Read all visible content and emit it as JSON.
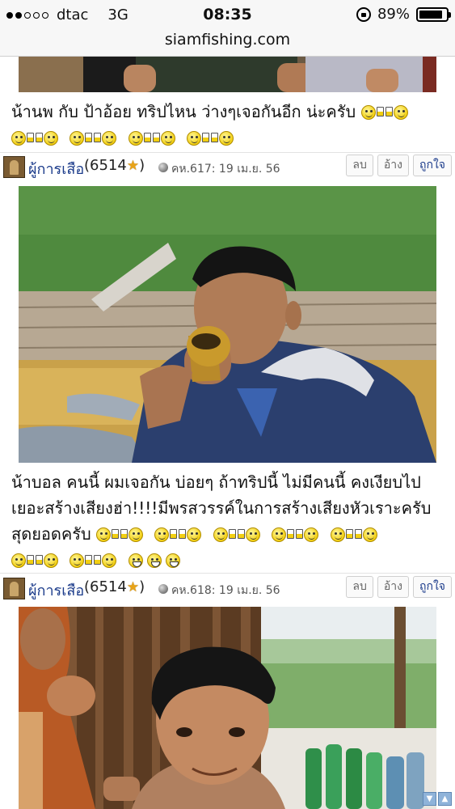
{
  "status_bar": {
    "carrier": "dtac",
    "network": "3G",
    "signal_dots_filled": 2,
    "signal_dots_total": 5,
    "time": "08:35",
    "battery": "89%",
    "battery_level": 0.89
  },
  "browser": {
    "url": "siamfishing.com"
  },
  "posts": [
    {
      "text": "น้านพ กับ ป้าอ้อย ทริปไหน ว่างๆเจอกันอีก น่ะครับ"
    },
    {
      "username": "ผู้การเสือ",
      "score": "(6514",
      "score_close": ")",
      "meta": "คห.617: 19 เม.ย. 56",
      "actions": [
        "ลบ",
        "อ้าง",
        "ถูกใจ"
      ],
      "text_line1": "น้าบอล คนนี้ ผมเจอกัน บ่อยๆ ถ้าทริปนี้ ไม่มีคนนี้ คงเงียบไป",
      "text_line2": "เยอะสร้างเสียงฮ่า!!!!มีพรสวรรค์ในการสร้างเสียงหัวเราะครับ",
      "text_line3": "สุดยอดครับ"
    },
    {
      "username": "ผู้การเสือ",
      "score": "(6514",
      "score_close": ")",
      "meta": "คห.618: 19 เม.ย. 56",
      "actions": [
        "ลบ",
        "อ้าง",
        "ถูกใจ"
      ]
    }
  ],
  "icons": {
    "star": "star-icon",
    "emoticon_cheers": "cheers-emoticon-icon",
    "emoticon_laugh": "laugh-emoticon-icon"
  },
  "scroll_buttons": [
    "▼",
    "▲"
  ],
  "colors": {
    "username": "#1a3a8a",
    "star": "#e8a317",
    "link_like": "#1a3a8a"
  }
}
